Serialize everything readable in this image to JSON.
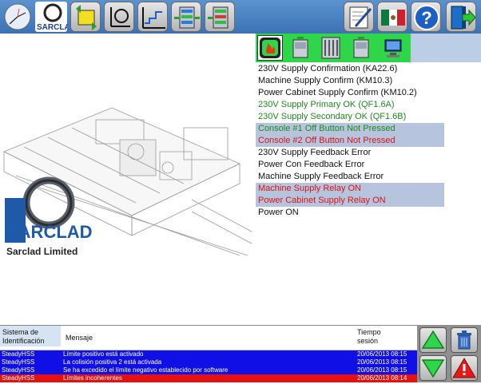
{
  "brand": {
    "logo_text": "SARCLAD",
    "company": "Sarclad Limited"
  },
  "toolbar": {
    "icons": [
      "clock-icon",
      "sarclad-logo-icon",
      "machine-power-icon",
      "loop-process-icon",
      "sequence-chart-icon",
      "module-stack-icon",
      "module-stack-alt-icon",
      "edit-notes-icon",
      "mexico-flag-icon",
      "help-icon",
      "exit-door-icon"
    ]
  },
  "status_icons": [
    "fire-alarm-icon",
    "cabinet-a-icon",
    "rack-icon",
    "cabinet-b-icon",
    "computer-icon"
  ],
  "status_items": [
    {
      "text": "230V Supply Confirmation (KA22.6)",
      "color": "black",
      "highlight": false
    },
    {
      "text": "Machine Supply Confirm (KM10.3)",
      "color": "black",
      "highlight": false
    },
    {
      "text": "Power Cabinet Supply Confirm (KM10.2)",
      "color": "black",
      "highlight": false
    },
    {
      "text": "230V Supply Primary OK (QF1.6A)",
      "color": "green",
      "highlight": false
    },
    {
      "text": "230V Supply Secondary OK (QF1.6B)",
      "color": "green",
      "highlight": false
    },
    {
      "text": "Console #1 Off Button Not Pressed",
      "color": "green",
      "highlight": true
    },
    {
      "text": "Console #2 Off Button Not Pressed",
      "color": "red",
      "highlight": true
    },
    {
      "text": "230V Supply Feedback Error",
      "color": "black",
      "highlight": false
    },
    {
      "text": "Power Con Feedback Error",
      "color": "black",
      "highlight": false
    },
    {
      "text": "Machine Supply Feedback Error",
      "color": "black",
      "highlight": false
    },
    {
      "text": "Machine Supply Relay ON",
      "color": "red",
      "highlight": true
    },
    {
      "text": "Power Cabinet Supply Relay ON",
      "color": "red",
      "highlight": true
    },
    {
      "text": "Power ON",
      "color": "black",
      "highlight": false
    }
  ],
  "log": {
    "headers": {
      "id_line1": "Sistema de",
      "id_line2": "Identificación",
      "message": "Mensaje",
      "time_line1": "Tiempo",
      "time_line2": "sesión"
    },
    "rows": [
      {
        "id": "SteadyHSS",
        "message": "Límite positivo está activado",
        "time": "20/06/2013 08:15",
        "color": "#1010e6"
      },
      {
        "id": "SteadyHSS",
        "message": "La colisión positiva 2 está activada",
        "time": "20/06/2013 08:15",
        "color": "#1010e6"
      },
      {
        "id": "SteadyHSS",
        "message": "Se ha excedido el límite negativo establecido por software",
        "time": "20/06/2013 08:15",
        "color": "#1010e6"
      },
      {
        "id": "SteadyHSS",
        "message": "Límites incoherentes",
        "time": "20/06/2013 08:14",
        "color": "#e61010"
      }
    ]
  },
  "side_buttons": [
    "scroll-up-icon",
    "delete-icon",
    "scroll-down-icon",
    "alarm-warning-icon"
  ],
  "colors": {
    "toolbar": "#4a82c4",
    "status_bar": "#2fd64a",
    "highlight": "#b6c4dd",
    "green_text": "#1e8a1e",
    "red_text": "#d81414"
  }
}
